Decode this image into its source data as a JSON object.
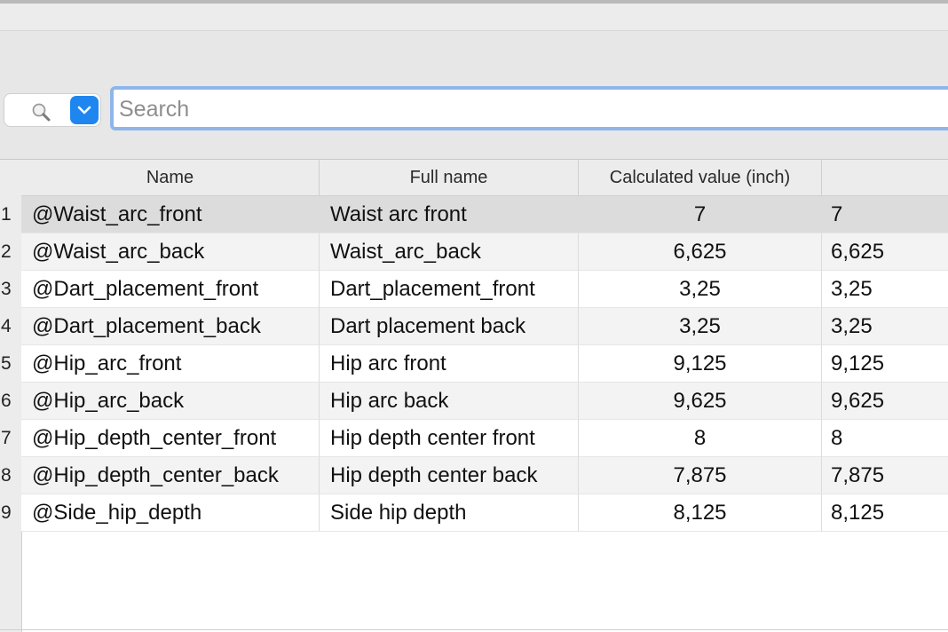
{
  "search": {
    "placeholder": "Search",
    "value": ""
  },
  "icons": {
    "search": "magnifier-icon",
    "dropdown": "chevron-down-icon"
  },
  "colors": {
    "accent": "#1f86f0",
    "focus_ring": "#8fb6ea",
    "selected_row": "#dcdcdc"
  },
  "table": {
    "columns": [
      "Name",
      "Full name",
      "Calculated value (inch)",
      ""
    ],
    "rows": [
      {
        "num": "1",
        "name": "@Waist_arc_front",
        "full": "Waist arc front",
        "calc": "7",
        "value": "7"
      },
      {
        "num": "2",
        "name": "@Waist_arc_back",
        "full": "Waist_arc_back",
        "calc": "6,625",
        "value": "6,625"
      },
      {
        "num": "3",
        "name": "@Dart_placement_front",
        "full": "Dart_placement_front",
        "calc": "3,25",
        "value": "3,25"
      },
      {
        "num": "4",
        "name": "@Dart_placement_back",
        "full": "Dart placement back",
        "calc": "3,25",
        "value": "3,25"
      },
      {
        "num": "5",
        "name": "@Hip_arc_front",
        "full": "Hip arc front",
        "calc": "9,125",
        "value": "9,125"
      },
      {
        "num": "6",
        "name": "@Hip_arc_back",
        "full": "Hip arc back",
        "calc": "9,625",
        "value": "9,625"
      },
      {
        "num": "7",
        "name": "@Hip_depth_center_front",
        "full": "Hip depth center front",
        "calc": "8",
        "value": "8"
      },
      {
        "num": "8",
        "name": "@Hip_depth_center_back",
        "full": "Hip depth center back",
        "calc": "7,875",
        "value": "7,875"
      },
      {
        "num": "9",
        "name": "@Side_hip_depth",
        "full": "Side hip depth",
        "calc": "8,125",
        "value": "8,125"
      }
    ]
  }
}
